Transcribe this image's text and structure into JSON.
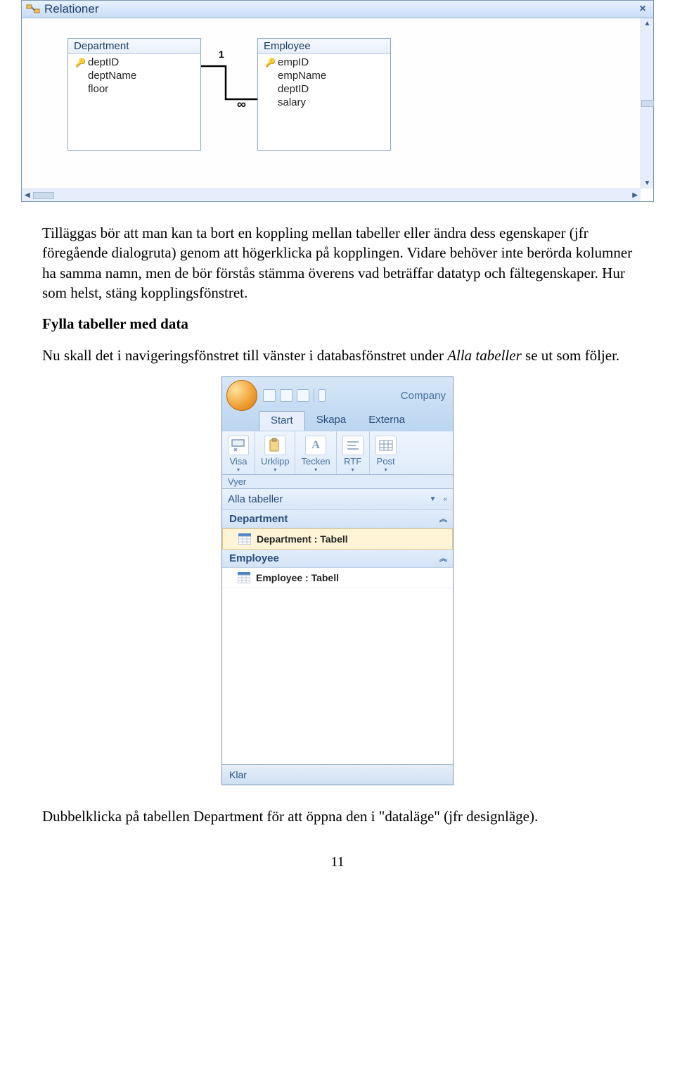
{
  "relations": {
    "title": "Relationer",
    "tables": [
      {
        "name": "Department",
        "fields": [
          {
            "name": "deptID",
            "pk": true
          },
          {
            "name": "deptName",
            "pk": false
          },
          {
            "name": "floor",
            "pk": false
          }
        ]
      },
      {
        "name": "Employee",
        "fields": [
          {
            "name": "empID",
            "pk": true
          },
          {
            "name": "empName",
            "pk": false
          },
          {
            "name": "deptID",
            "pk": false
          },
          {
            "name": "salary",
            "pk": false
          }
        ]
      }
    ],
    "cardinality": {
      "one": "1",
      "many": "∞"
    }
  },
  "prose": {
    "p1": "Tilläggas bör att man kan ta bort en koppling mellan tabeller eller ändra dess egenskaper (jfr föregående dialogruta) genom att högerklicka på kopplingen. Vidare behöver inte berörda kolumner ha samma namn, men de bör förstås stämma överens vad beträffar datatyp och fältegenskaper. Hur som helst, stäng kopplingsfönstret.",
    "h1": "Fylla tabeller med data",
    "p2a": "Nu skall det i navigeringsfönstret till vänster i databasfönstret under ",
    "p2em": "Alla tabeller",
    "p2b": " se ut som följer.",
    "p3a": "Dubbelklicka på tabellen Department för att öppna den i \"dataläge\" (jfr designläge)."
  },
  "nav": {
    "app_title": "Company",
    "tabs": {
      "start": "Start",
      "skapa": "Skapa",
      "externa": "Externa"
    },
    "ribbon": {
      "visa": "Visa",
      "urklipp": "Urklipp",
      "tecken": "Tecken",
      "rtf": "RTF",
      "post": "Post"
    },
    "vyer": "Vyer",
    "all_tables": "Alla tabeller",
    "groups": [
      {
        "name": "Department",
        "item": "Department : Tabell"
      },
      {
        "name": "Employee",
        "item": "Employee : Tabell"
      }
    ],
    "status": "Klar"
  },
  "pagenum": "11"
}
